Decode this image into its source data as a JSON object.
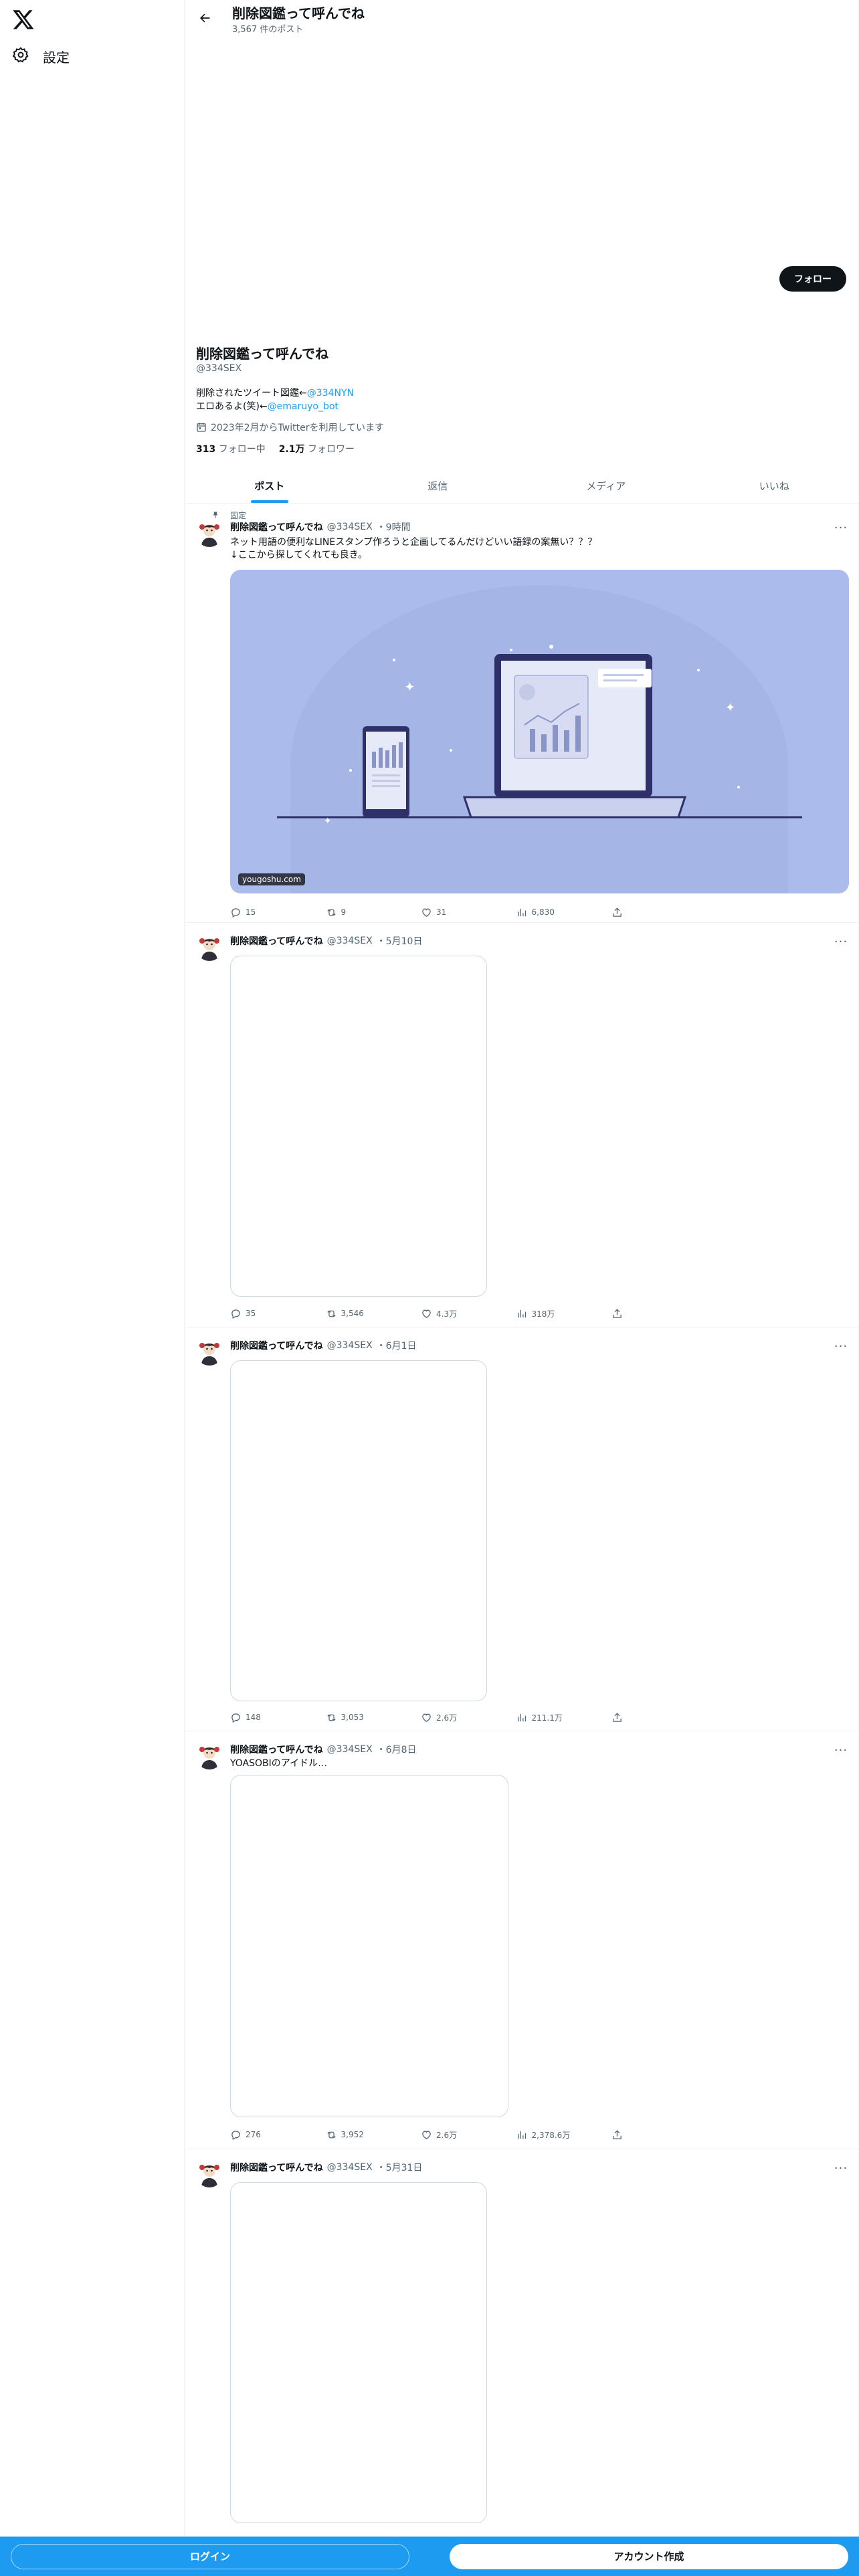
{
  "header": {
    "title": "削除図鑑って呼んでね",
    "post_count": "3,567 件のポスト",
    "follow_label": "フォロー"
  },
  "nav": {
    "settings_label": "設定"
  },
  "profile": {
    "name": "削除図鑑って呼んでね",
    "handle": "@334SEX",
    "bio_line1_prefix": "削除されたツイート図鑑←",
    "bio_line1_link": "@334NYN",
    "bio_line2_prefix": "エロあるよ(笑)←",
    "bio_line2_link": "@emaruyo_bot",
    "joined": "2023年2月からTwitterを利用しています",
    "following_count": "313",
    "following_label": "フォロー中",
    "followers_count": "2.1万",
    "followers_label": "フォロワー"
  },
  "tabs": [
    {
      "label": "ポスト"
    },
    {
      "label": "返信"
    },
    {
      "label": "メディア"
    },
    {
      "label": "いいね"
    }
  ],
  "posts": [
    {
      "pinned_label": "固定",
      "name": "削除図鑑って呼んでね",
      "handle": "@334SEX",
      "time": "・9時間",
      "text_line1": "ネット用語の便利なLINEスタンプ作ろうと企画してるんだけどいい語録の案無い？？？",
      "text_line2": "↓ここから探してくれても良き。",
      "media_caption": "yougoshu.com",
      "replies": "15",
      "reposts": "9",
      "likes": "31",
      "views": "6,830"
    },
    {
      "name": "削除図鑑って呼んでね",
      "handle": "@334SEX",
      "time": "・5月10日",
      "replies": "35",
      "reposts": "3,546",
      "likes": "4.3万",
      "views": "318万"
    },
    {
      "name": "削除図鑑って呼んでね",
      "handle": "@334SEX",
      "time": "・6月1日",
      "replies": "148",
      "reposts": "3,053",
      "likes": "2.6万",
      "views": "211.1万"
    },
    {
      "name": "削除図鑑って呼んでね",
      "handle": "@334SEX",
      "time": "・6月8日",
      "text_line1": "YOASOBIのアイドル…",
      "replies": "276",
      "reposts": "3,952",
      "likes": "2.6万",
      "views": "2,378.6万"
    },
    {
      "name": "削除図鑑って呼んでね",
      "handle": "@334SEX",
      "time": "・5月31日"
    }
  ],
  "bottom": {
    "login_label": "ログイン",
    "signup_label": "アカウント作成"
  },
  "colors": {
    "accent": "#1d9bf0",
    "text": "#0f1419",
    "muted": "#536471",
    "card_bg": "#abbcec"
  }
}
